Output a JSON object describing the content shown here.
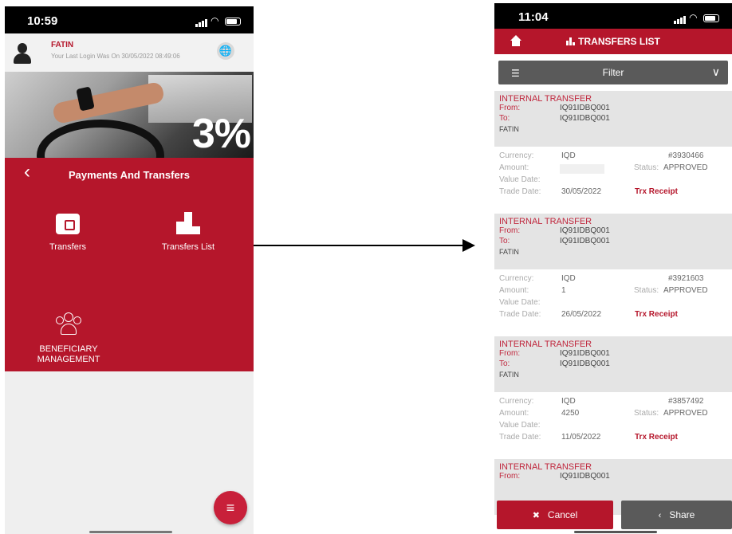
{
  "left_screen": {
    "status_time": "10:59",
    "user": {
      "name": "FATIN",
      "last_login": "Your Last Login Was On 30/05/2022 08:49:06"
    },
    "banner_text": "3%",
    "panel_title": "Payments And Transfers",
    "tiles": [
      {
        "label": "Transfers"
      },
      {
        "label": "Transfers List"
      },
      {
        "label": "BENEFICIARY MANAGEMENT"
      }
    ],
    "fab_icon": "menu-icon"
  },
  "right_screen": {
    "status_time": "11:04",
    "header_title": "TRANSFERS LIST",
    "filter_label": "Filter",
    "labels": {
      "from": "From:",
      "to": "To:",
      "currency": "Currency:",
      "amount": "Amount:",
      "status": "Status:",
      "value_date": "Value Date:",
      "trade_date": "Trade Date:",
      "receipt": "Trx Receipt"
    },
    "transfers": [
      {
        "type": "INTERNAL TRANSFER",
        "from": "IQ91IDBQ001",
        "to": "IQ91IDBQ001",
        "beneficiary": "FATIN",
        "currency": "IQD",
        "reference": "#3930466",
        "amount": "",
        "status": "APPROVED",
        "value_date": "",
        "trade_date": "30/05/2022"
      },
      {
        "type": "INTERNAL TRANSFER",
        "from": "IQ91IDBQ001",
        "to": "IQ91IDBQ001",
        "beneficiary": "FATIN",
        "currency": "IQD",
        "reference": "#3921603",
        "amount": "1",
        "status": "APPROVED",
        "value_date": "",
        "trade_date": "26/05/2022"
      },
      {
        "type": "INTERNAL TRANSFER",
        "from": "IQ91IDBQ001",
        "to": "IQ91IDBQ001",
        "beneficiary": "FATIN",
        "currency": "IQD",
        "reference": "#3857492",
        "amount": "4250",
        "status": "APPROVED",
        "value_date": "",
        "trade_date": "11/05/2022"
      },
      {
        "type": "INTERNAL TRANSFER",
        "from": "IQ91IDBQ001"
      }
    ],
    "buttons": {
      "cancel": "Cancel",
      "share": "Share"
    }
  },
  "colors": {
    "brand_red": "#b5162b",
    "dark_gray": "#5a5a5a"
  }
}
